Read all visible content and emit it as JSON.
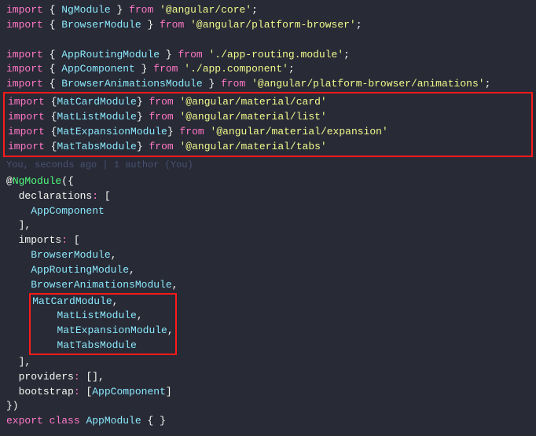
{
  "imports": {
    "ngmodule": {
      "sym": "NgModule",
      "from": "'@angular/core'"
    },
    "browsermod": {
      "sym": "BrowserModule",
      "from": "'@angular/platform-browser'"
    },
    "approuting": {
      "sym": "AppRoutingModule",
      "from": "'./app-routing.module'"
    },
    "appcomp": {
      "sym": "AppComponent",
      "from": "'./app.component'"
    },
    "browseranim": {
      "sym": "BrowserAnimationsModule",
      "from": "'@angular/platform-browser/animations'"
    },
    "matcard": {
      "sym": "MatCardModule",
      "from": "'@angular/material/card'"
    },
    "matlist": {
      "sym": "MatListModule",
      "from": "'@angular/material/list'"
    },
    "matexp": {
      "sym": "MatExpansionModule",
      "from": "'@angular/material/expansion'"
    },
    "mattabs": {
      "sym": "MatTabsModule",
      "from": "'@angular/material/tabs'"
    }
  },
  "gitlens": "You, seconds ago | 1 author (You)",
  "decorator": "NgModule",
  "props": {
    "declarations": "declarations",
    "imports": "imports",
    "providers": "providers",
    "bootstrap": "bootstrap"
  },
  "decl_items": [
    "AppComponent"
  ],
  "import_items_a": [
    "BrowserModule",
    "AppRoutingModule",
    "BrowserAnimationsModule"
  ],
  "import_items_b": [
    "MatCardModule",
    "MatListModule",
    "MatExpansionModule",
    "MatTabsModule"
  ],
  "bootstrap_items": [
    "AppComponent"
  ],
  "export_line": {
    "kw1": "export",
    "kw2": "class",
    "name": "AppModule"
  },
  "kw": {
    "import": "import",
    "from": "from"
  }
}
